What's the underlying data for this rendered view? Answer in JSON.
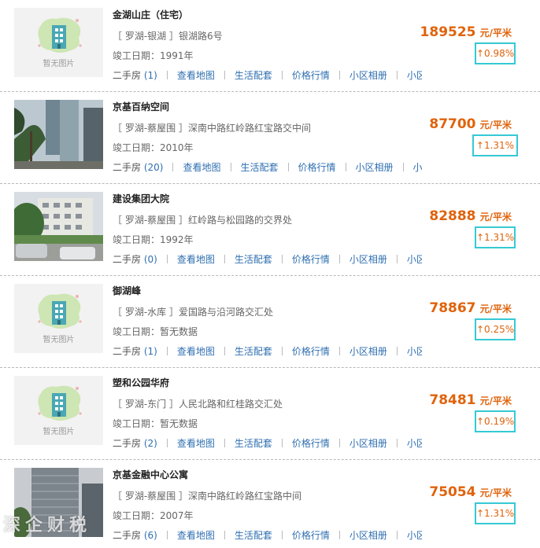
{
  "placeholder_caption": "暂无图片",
  "labels": {
    "built_prefix": "竣工日期：",
    "ershou": "二手房",
    "map": "查看地图",
    "life": "生活配套",
    "price": "价格行情",
    "album": "小区相册",
    "more": "小区"
  },
  "price_unit": "元/平米",
  "accent_colors": {
    "price": "#e0630c",
    "link": "#2f6fb0",
    "highlight_box": "#35c9d4"
  },
  "listings": [
    {
      "name": "金湖山庄（住宅）",
      "area": "［ 罗湖-银湖 ］",
      "address": "银湖路6号",
      "built_date": "1991年",
      "ershou_count": "(1)",
      "price": "189525",
      "change": "↑0.98%",
      "image": "placeholder"
    },
    {
      "name": "京基百纳空间",
      "area": "［ 罗湖-蔡屋围 ］",
      "address": "深南中路红岭路红宝路交中间",
      "built_date": "2010年",
      "ershou_count": "(20)",
      "price": "87700",
      "change": "↑1.31%",
      "image": "photo-towers"
    },
    {
      "name": "建设集团大院",
      "area": "［ 罗湖-蔡屋围 ］",
      "address": "红岭路与松园路的交界处",
      "built_date": "1992年",
      "ershou_count": "(0)",
      "price": "82888",
      "change": "↑1.31%",
      "image": "photo-compound"
    },
    {
      "name": "御湖峰",
      "area": "［ 罗湖-水库 ］",
      "address": "爱国路与沿河路交汇处",
      "built_date": "暂无数据",
      "ershou_count": "(1)",
      "price": "78867",
      "change": "↑0.25%",
      "image": "placeholder"
    },
    {
      "name": "塑和公园华府",
      "area": "［ 罗湖-东门 ］",
      "address": "人民北路和红桂路交汇处",
      "built_date": "暂无数据",
      "ershou_count": "(2)",
      "price": "78481",
      "change": "↑0.19%",
      "image": "placeholder"
    },
    {
      "name": "京基金融中心公寓",
      "area": "［ 罗湖-蔡屋围 ］",
      "address": "深南中路红岭路红宝路中间",
      "built_date": "2007年",
      "ershou_count": "(6)",
      "price": "75054",
      "change": "↑1.31%",
      "image": "photo-highrise"
    }
  ],
  "watermark": "深企财税"
}
